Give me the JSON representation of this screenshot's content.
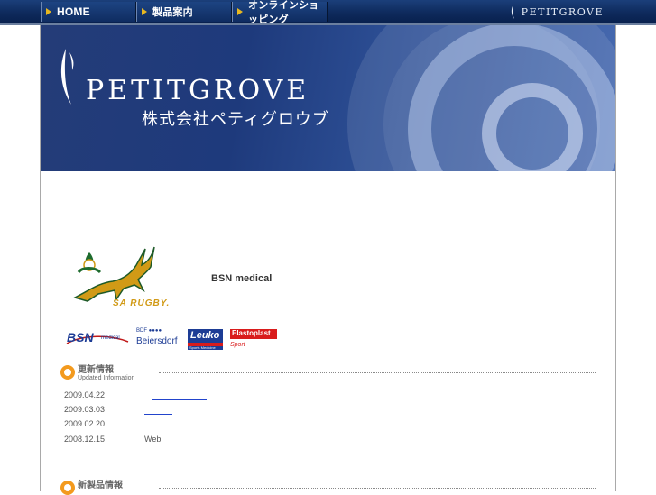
{
  "nav": {
    "home_label": "HOME",
    "products_label": "製品案内",
    "shop_label": "オンラインショッピング",
    "logo_text": "PETITGROVE",
    "colors": {
      "bar": "#0e2a5c",
      "arrow": "#e8b820"
    }
  },
  "banner": {
    "brand": "PETITGROVE",
    "company": "株式会社ペティグロウブ"
  },
  "sponsors": {
    "rugby_caption": "SA RUGBY.",
    "bsn_medical": "BSN medical",
    "bsn_logo_main": "BSN",
    "bsn_logo_sub": "medical",
    "bdf_small": "BDF ●●●●",
    "bdf_name": "Beiersdorf",
    "leuko_name": "Leuko",
    "leuko_sub": "Sports Medicine",
    "elastoplast_name": "Elastoplast",
    "elastoplast_sub": "Sport"
  },
  "updates": {
    "heading_jp": "更新情報",
    "heading_en": "Updated Information",
    "items": [
      {
        "date": "2009.04.22",
        "text": ""
      },
      {
        "date": "2009.03.03",
        "text": ""
      },
      {
        "date": "2009.02.20",
        "text": ""
      },
      {
        "date": "2008.12.15",
        "text": "Web"
      }
    ]
  },
  "new_products": {
    "heading_jp": "新製品情報"
  }
}
